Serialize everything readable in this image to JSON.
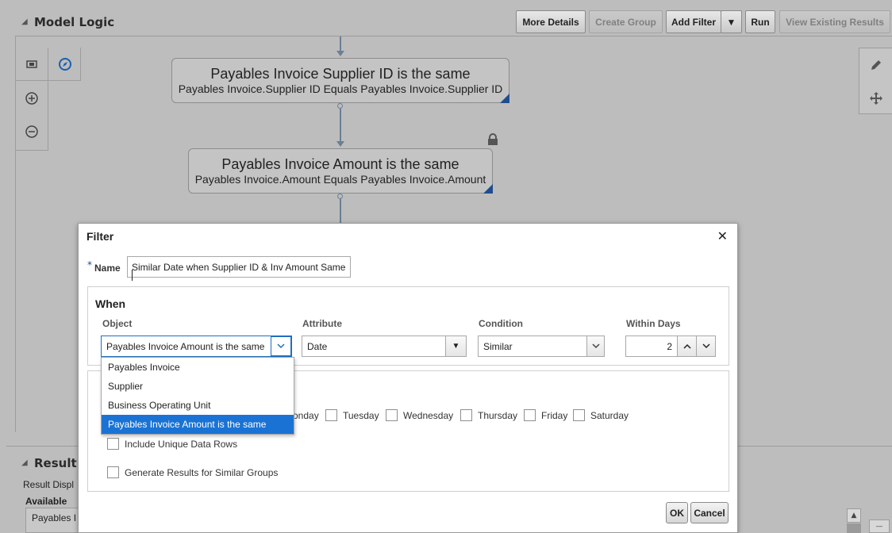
{
  "panel": {
    "title": "Model Logic",
    "toolbar": {
      "more_details": "More Details",
      "create_group": "Create Group",
      "add_filter": "Add Filter",
      "run": "Run",
      "view_existing": "View Existing Results"
    }
  },
  "flow": {
    "nodes": [
      {
        "title": "Payables Invoice Supplier ID is the same",
        "subtitle": "Payables Invoice.Supplier ID Equals Payables Invoice.Supplier ID"
      },
      {
        "title": "Payables Invoice Amount is the same",
        "subtitle": "Payables Invoice.Amount Equals Payables Invoice.Amount"
      }
    ]
  },
  "result_panel": {
    "title": "Result D",
    "display_label": "Result Displ",
    "available_label": "Available",
    "first_item": "Payables I"
  },
  "dialog": {
    "title": "Filter",
    "name_label": "Name",
    "name_value": "Similar Date when Supplier ID & Inv Amount Same",
    "when_label": "When",
    "columns": {
      "object": "Object",
      "attribute": "Attribute",
      "condition": "Condition",
      "within_days": "Within Days"
    },
    "object_value": "Payables Invoice Amount is the same",
    "attribute_value": "Date",
    "condition_value": "Similar",
    "within_days_value": "2",
    "object_options": [
      "Payables Invoice",
      "Supplier",
      "Business Operating Unit",
      "Payables Invoice Amount is the same"
    ],
    "days": [
      "onday",
      "Tuesday",
      "Wednesday",
      "Thursday",
      "Friday",
      "Saturday"
    ],
    "include_unique": "Include Unique Data Rows",
    "generate_similar": "Generate Results for Similar Groups",
    "ok": "OK",
    "cancel": "Cancel"
  },
  "colors": {
    "accent": "#1a73d4",
    "node_corner": "#1f4d8c",
    "flow_line": "#6b7f95"
  }
}
